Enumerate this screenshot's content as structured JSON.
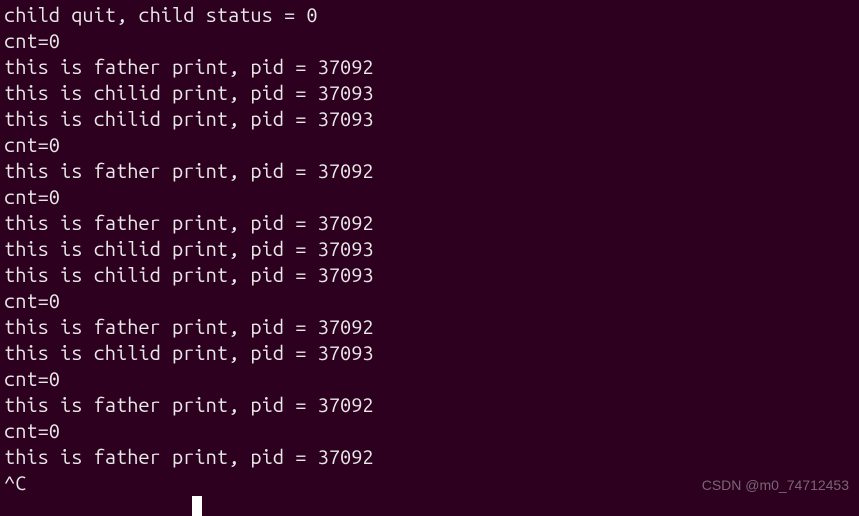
{
  "terminal": {
    "lines": [
      "child quit, child status = 0",
      "cnt=0",
      "this is father print, pid = 37092",
      "this is chilid print, pid = 37093",
      "this is chilid print, pid = 37093",
      "cnt=0",
      "this is father print, pid = 37092",
      "cnt=0",
      "this is father print, pid = 37092",
      "this is chilid print, pid = 37093",
      "this is chilid print, pid = 37093",
      "cnt=0",
      "this is father print, pid = 37092",
      "this is chilid print, pid = 37093",
      "cnt=0",
      "this is father print, pid = 37092",
      "cnt=0",
      "this is father print, pid = 37092",
      "^C"
    ]
  },
  "watermark": "CSDN @m0_74712453"
}
